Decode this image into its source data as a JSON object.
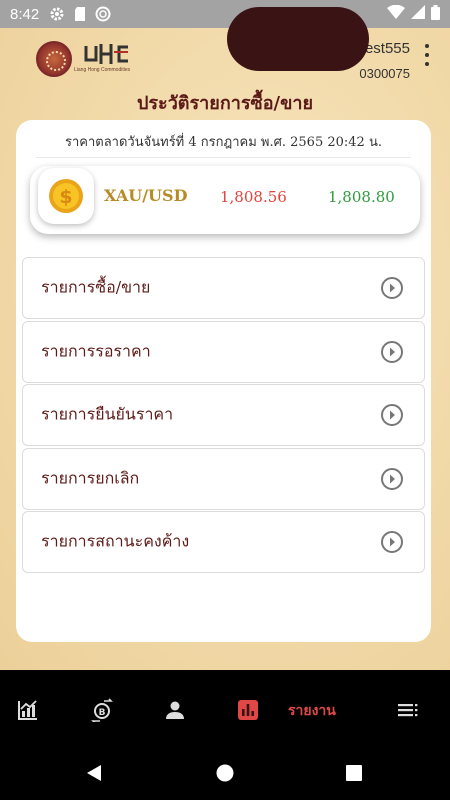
{
  "status_bar": {
    "time": "8:42",
    "icons": [
      "settings-icon",
      "sd-card-icon",
      "sync-icon",
      "wifi-icon",
      "signal-icon",
      "battery-icon"
    ]
  },
  "header": {
    "brand_logo_text": "LHC",
    "brand_subtitle": "Liang Hong Commodities",
    "username": "test555",
    "account_no": "0300075",
    "more_icon": "more-vertical-icon"
  },
  "page": {
    "title": "ประวัติรายการซื้อ/ขาย"
  },
  "market": {
    "date_text": "ราคาตลาดวันจันทร์ที่ 4 กรกฎาคม พ.ศ. 2565  20:42 น.",
    "quote": {
      "icon": "coin-dollar-icon",
      "symbol": "XAU/USD",
      "bid": "1,808.56",
      "ask": "1,808.80",
      "bid_color": "#e0443c",
      "ask_color": "#2e9b3c"
    }
  },
  "menu": {
    "items": [
      {
        "label": "รายการซื้อ/ขาย"
      },
      {
        "label": "รายการรอราคา"
      },
      {
        "label": "รายการยืนยันราคา"
      },
      {
        "label": "รายการยกเลิก"
      },
      {
        "label": "รายการสถานะคงค้าง"
      }
    ]
  },
  "bottom_nav": {
    "items": [
      {
        "icon": "chart-icon"
      },
      {
        "icon": "bitcoin-exchange-icon"
      },
      {
        "icon": "person-icon"
      },
      {
        "icon": "bar-report-icon",
        "label": "รายงาน",
        "active": true
      },
      {
        "icon": "list-menu-icon"
      }
    ],
    "active_color": "#e04848"
  },
  "system_nav": {
    "icons": [
      "back-icon",
      "home-icon",
      "recents-icon"
    ]
  },
  "colors": {
    "brand_maroon": "#5b1a17",
    "gold": "#b88a25",
    "background": "#f3dcae"
  }
}
